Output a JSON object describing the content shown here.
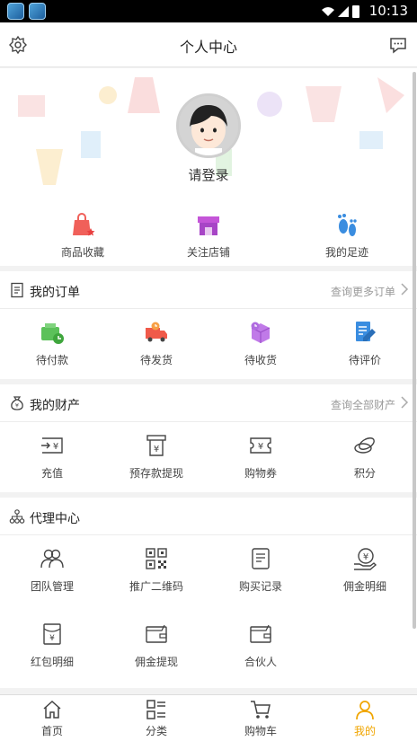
{
  "status": {
    "time": "10:13"
  },
  "header": {
    "title": "个人中心"
  },
  "profile": {
    "login_label": "请登录"
  },
  "quick_links": [
    {
      "label": "商品收藏",
      "icon": "bag-heart-icon"
    },
    {
      "label": "关注店铺",
      "icon": "store-icon"
    },
    {
      "label": "我的足迹",
      "icon": "footprint-icon"
    }
  ],
  "orders": {
    "title": "我的订单",
    "more": "查询更多订单",
    "items": [
      {
        "label": "待付款",
        "icon": "wallet-icon"
      },
      {
        "label": "待发货",
        "icon": "truck-icon"
      },
      {
        "label": "待收货",
        "icon": "box-icon"
      },
      {
        "label": "待评价",
        "icon": "edit-icon"
      }
    ]
  },
  "assets": {
    "title": "我的财产",
    "more": "查询全部财产",
    "items": [
      {
        "label": "充值",
        "icon": "recharge-icon"
      },
      {
        "label": "预存款提现",
        "icon": "withdraw-icon"
      },
      {
        "label": "购物券",
        "icon": "coupon-icon"
      },
      {
        "label": "积分",
        "icon": "points-icon"
      }
    ]
  },
  "agent": {
    "title": "代理中心",
    "items": [
      {
        "label": "团队管理",
        "icon": "team-icon"
      },
      {
        "label": "推广二维码",
        "icon": "qrcode-icon"
      },
      {
        "label": "购买记录",
        "icon": "record-icon"
      },
      {
        "label": "佣金明细",
        "icon": "commission-icon"
      },
      {
        "label": "红包明细",
        "icon": "redpacket-icon"
      },
      {
        "label": "佣金提现",
        "icon": "wallet-out-icon"
      },
      {
        "label": "合伙人",
        "icon": "partner-icon"
      }
    ]
  },
  "tabbar": [
    {
      "label": "首页",
      "icon": "home-icon"
    },
    {
      "label": "分类",
      "icon": "category-icon"
    },
    {
      "label": "购物车",
      "icon": "cart-icon"
    },
    {
      "label": "我的",
      "icon": "user-icon",
      "active": true
    }
  ],
  "colors": {
    "accent": "#f0a500",
    "order_green": "#5cc15a",
    "order_red": "#f05a4a",
    "order_purple": "#b06ce0",
    "order_blue": "#3a8de0"
  }
}
